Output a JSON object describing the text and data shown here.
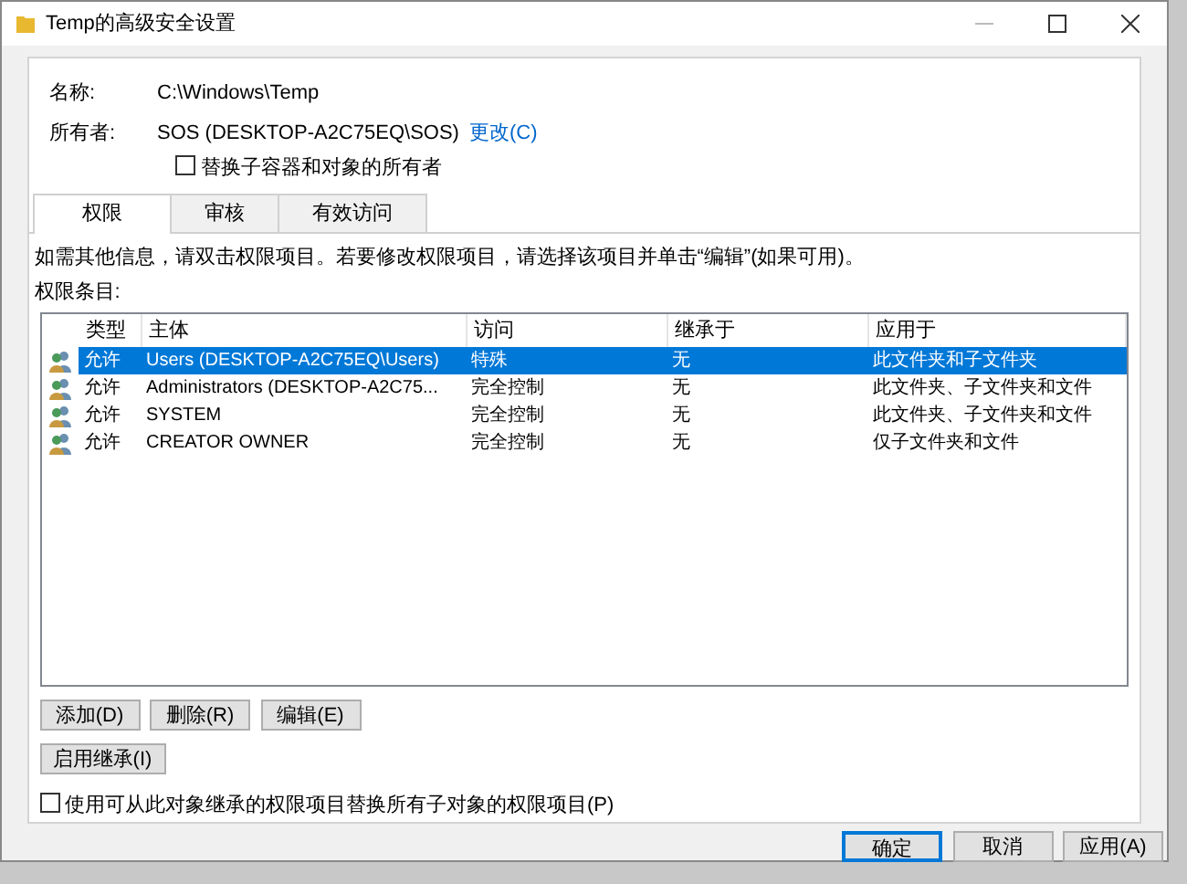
{
  "window": {
    "title": "Temp的高级安全设置"
  },
  "name": {
    "label": "名称:",
    "value": "C:\\Windows\\Temp"
  },
  "owner": {
    "label": "所有者:",
    "value": "SOS (DESKTOP-A2C75EQ\\SOS)",
    "change_link": "更改(C)"
  },
  "replace_owner": {
    "label": "替换子容器和对象的所有者",
    "checked": false
  },
  "tabs": [
    {
      "label": "权限",
      "selected": true
    },
    {
      "label": "审核",
      "selected": false
    },
    {
      "label": "有效访问",
      "selected": false
    }
  ],
  "info_text": "如需其他信息，请双击权限项目。若要修改权限项目，请选择该项目并单击“编辑”(如果可用)。",
  "entries_label": "权限条目:",
  "table": {
    "columns": [
      "类型",
      "主体",
      "访问",
      "继承于",
      "应用于"
    ],
    "rows": [
      {
        "cells": [
          "允许",
          "Users (DESKTOP-A2C75EQ\\Users)",
          "特殊",
          "无",
          "此文件夹和子文件夹"
        ],
        "selected": true
      },
      {
        "cells": [
          "允许",
          "Administrators (DESKTOP-A2C75...",
          "完全控制",
          "无",
          "此文件夹、子文件夹和文件"
        ],
        "selected": false
      },
      {
        "cells": [
          "允许",
          "SYSTEM",
          "完全控制",
          "无",
          "此文件夹、子文件夹和文件"
        ],
        "selected": false
      },
      {
        "cells": [
          "允许",
          "CREATOR OWNER",
          "完全控制",
          "无",
          "仅子文件夹和文件"
        ],
        "selected": false
      }
    ]
  },
  "entry_buttons": [
    "添加(D)",
    "删除(R)",
    "编辑(E)"
  ],
  "inherit_button": "启用继承(I)",
  "replace_child": {
    "label": "使用可从此对象继承的权限项目替换所有子对象的权限项目(P)",
    "checked": false
  },
  "dialog_buttons": [
    {
      "label": "确定",
      "default": true
    },
    {
      "label": "取消",
      "default": false
    },
    {
      "label": "应用(A)",
      "default": false
    }
  ]
}
